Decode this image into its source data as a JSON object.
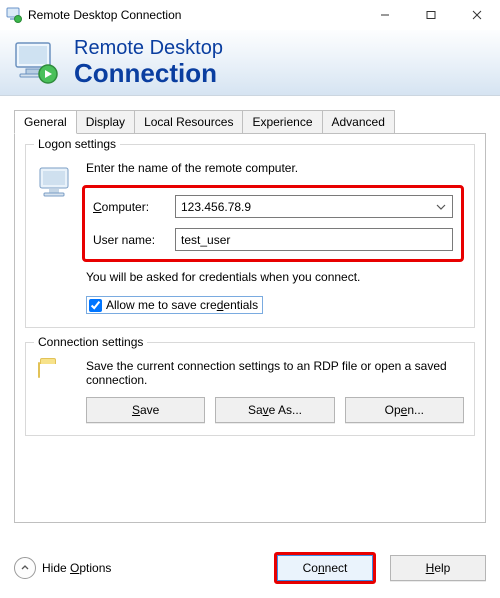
{
  "window": {
    "title": "Remote Desktop Connection"
  },
  "banner": {
    "line1": "Remote Desktop",
    "line2": "Connection"
  },
  "tabs": {
    "general": "General",
    "display": "Display",
    "local": "Local Resources",
    "exper": "Experience",
    "adv": "Advanced"
  },
  "logon": {
    "group_title": "Logon settings",
    "intro": "Enter the name of the remote computer.",
    "computer_label": "Computer:",
    "computer_value": "123.456.78.9",
    "user_label": "User name:",
    "user_value": "test_user",
    "cred_note": "You will be asked for credentials when you connect.",
    "allow_save_pre": "Allow me to save cre",
    "allow_save_u": "d",
    "allow_save_post": "entials"
  },
  "conn": {
    "group_title": "Connection settings",
    "intro": "Save the current connection settings to an RDP file or open a saved connection.",
    "save": "Save",
    "saveas": "Save As...",
    "open": "Open..."
  },
  "footer": {
    "hide_pre": "Hide ",
    "hide_u": "O",
    "hide_post": "ptions",
    "connect_pre": "Co",
    "connect_u": "n",
    "connect_post": "nect",
    "help_pre": "",
    "help_u": "H",
    "help_post": "elp"
  }
}
